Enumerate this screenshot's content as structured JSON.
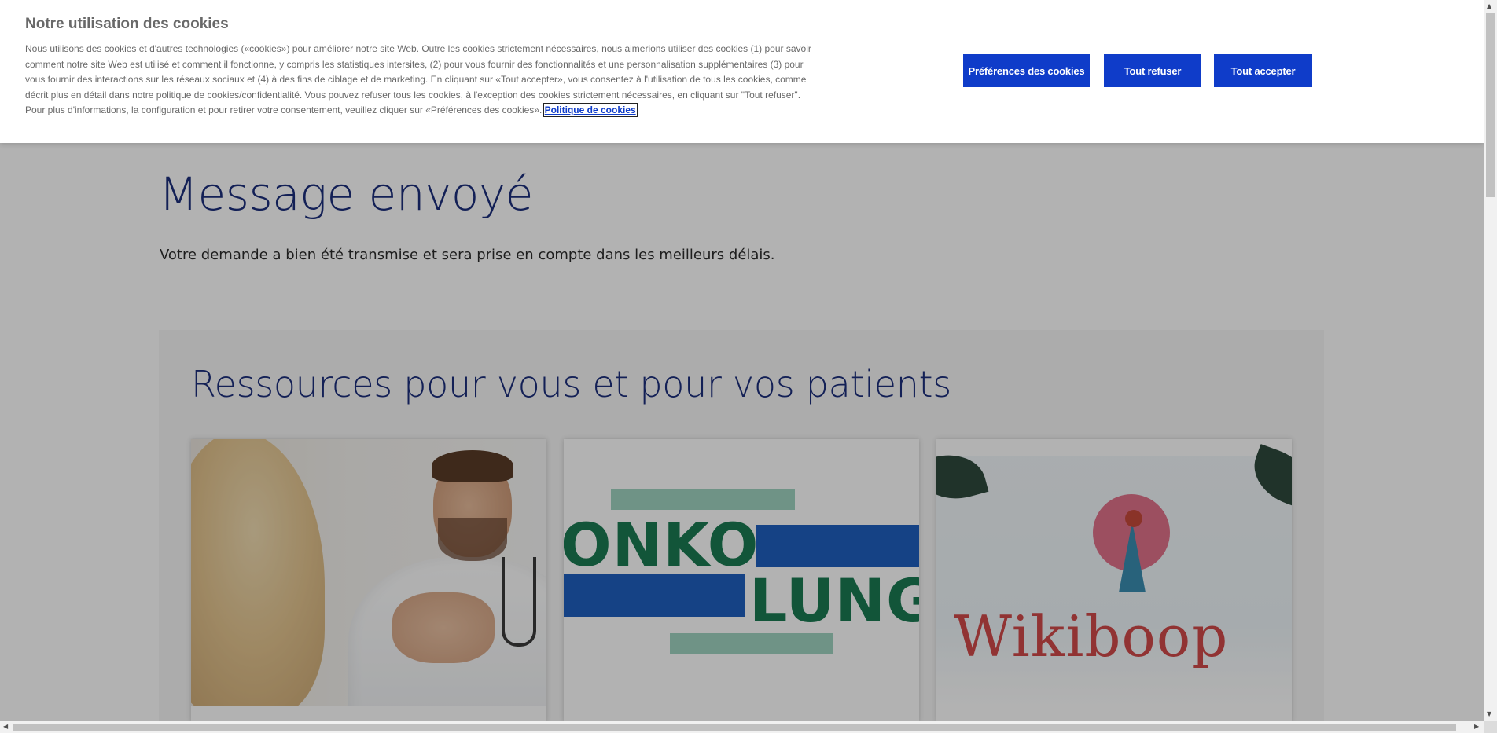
{
  "page": {
    "hero_title": "Message envoyé",
    "hero_subtitle": "Votre demande a bien été transmise et sera prise en compte dans les meilleurs délais.",
    "resources_title": "Ressources pour vous et pour vos patients",
    "cards": [
      {
        "image": "doctor-consultation-photo"
      },
      {
        "image": "onko-lung-logo",
        "logo_words": [
          "ONKO",
          "LUNG"
        ]
      },
      {
        "image": "wikiboop-logo",
        "logo_text": "Wikiboop"
      }
    ]
  },
  "cookie_banner": {
    "title": "Notre utilisation des cookies",
    "body": "Nous utilisons des cookies et d'autres technologies («cookies») pour améliorer notre site Web. Outre les cookies strictement nécessaires, nous aimerions utiliser des cookies (1) pour savoir comment notre site Web est utilisé et comment il fonctionne, y compris les statistiques intersites, (2) pour vous fournir des fonctionnalités et une personnalisation supplémentaires (3) pour vous fournir des interactions sur les réseaux sociaux et (4) à des fins de ciblage et de marketing. En cliquant sur «Tout accepter», vous consentez à l'utilisation de tous les cookies, comme décrit plus en détail dans notre politique de cookies/confidentialité. Vous pouvez refuser tous les cookies, à l'exception des cookies strictement nécessaires, en cliquant sur \"Tout refuser\". Pour plus d'informations, la configuration et pour retirer votre consentement, veuillez cliquer sur «Préférences des cookies».",
    "policy_link": "Politique de cookies",
    "buttons": {
      "preferences": "Préférences des cookies",
      "refuse_all": "Tout refuser",
      "accept_all": "Tout accepter"
    }
  },
  "colors": {
    "brand_blue": "#0f3cc9",
    "heading_navy": "#1c2e7c",
    "banner_text": "#696969",
    "overlay": "rgba(0,0,0,0.30)"
  },
  "scrollbars": {
    "vertical_up_icon": "arrow-up-icon",
    "vertical_down_icon": "arrow-down-icon",
    "horizontal_left_icon": "arrow-left-icon",
    "horizontal_right_icon": "arrow-right-icon"
  }
}
